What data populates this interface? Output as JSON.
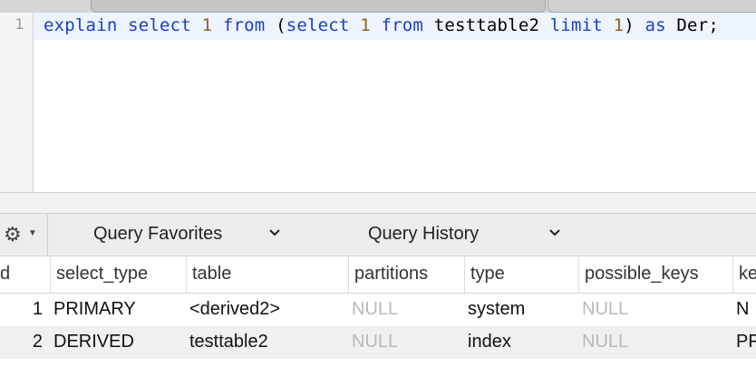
{
  "editor": {
    "line_number": "1",
    "tokens": [
      {
        "t": "explain",
        "c": "kw"
      },
      {
        "t": " ",
        "c": ""
      },
      {
        "t": "select",
        "c": "kw"
      },
      {
        "t": " ",
        "c": ""
      },
      {
        "t": "1",
        "c": "num"
      },
      {
        "t": " ",
        "c": ""
      },
      {
        "t": "from",
        "c": "kw"
      },
      {
        "t": " (",
        "c": ""
      },
      {
        "t": "select",
        "c": "kw"
      },
      {
        "t": " ",
        "c": ""
      },
      {
        "t": "1",
        "c": "num"
      },
      {
        "t": " ",
        "c": ""
      },
      {
        "t": "from",
        "c": "kw"
      },
      {
        "t": " testtable2 ",
        "c": ""
      },
      {
        "t": "limit",
        "c": "kw"
      },
      {
        "t": " ",
        "c": ""
      },
      {
        "t": "1",
        "c": "num"
      },
      {
        "t": ") ",
        "c": ""
      },
      {
        "t": "as",
        "c": "kw"
      },
      {
        "t": " Der;",
        "c": ""
      }
    ]
  },
  "toolbar": {
    "gear_icon": "gear-icon",
    "favorites_label": "Query Favorites",
    "history_label": "Query History"
  },
  "results": {
    "columns": [
      "d",
      "select_type",
      "table",
      "partitions",
      "type",
      "possible_keys",
      "ke"
    ],
    "rows": [
      [
        "1",
        "PRIMARY",
        "<derived2>",
        "NULL",
        "system",
        "NULL",
        "N"
      ],
      [
        "2",
        "DERIVED",
        "testtable2",
        "NULL",
        "index",
        "NULL",
        "PF"
      ]
    ]
  },
  "colors": {
    "keyword": "#1a3fc7",
    "number": "#9a5f1b",
    "null_text": "#b9b9b9",
    "current_line": "#eef4fd"
  }
}
